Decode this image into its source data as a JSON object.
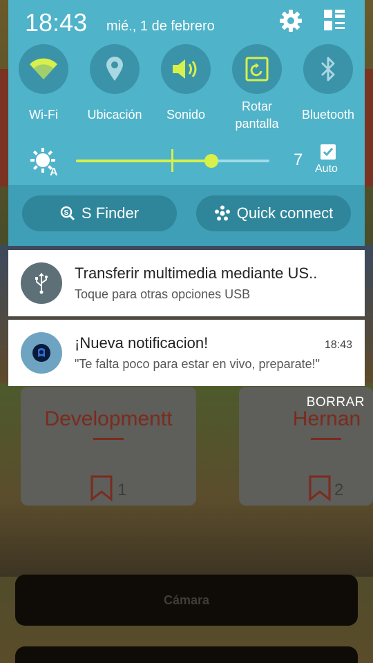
{
  "status_bar": {
    "time": "18:43",
    "date": "mié., 1 de febrero"
  },
  "quick_settings": {
    "tiles": [
      {
        "label": "Wi-Fi",
        "icon": "wifi-icon",
        "active": true
      },
      {
        "label": "Ubicación",
        "icon": "location-icon",
        "active": false
      },
      {
        "label": "Sonido",
        "icon": "sound-icon",
        "active": true
      },
      {
        "label": "Rotar pantalla",
        "icon": "rotate-icon",
        "active": true
      },
      {
        "label": "Bluetooth",
        "icon": "bluetooth-icon",
        "active": false
      }
    ],
    "brightness": {
      "value": "7",
      "level_fraction": 0.7,
      "auto_label": "Auto",
      "auto_checked": true
    },
    "s_finder_label": "S Finder",
    "quick_connect_label": "Quick connect"
  },
  "notifications": [
    {
      "title": "Transferir multimedia mediante US..",
      "body": "Toque para otras opciones USB",
      "icon": "usb-icon",
      "time": ""
    },
    {
      "title": "¡Nueva notificacion!",
      "body": "\"Te falta poco para estar en vivo, preparate!\"",
      "icon": "app-icon",
      "time": "18:43"
    }
  ],
  "background_app": {
    "clear_label": "BORRAR",
    "cards": [
      {
        "title": "Developmentt",
        "count": "1"
      },
      {
        "title": "Hernan",
        "count": "2"
      }
    ],
    "camera_button_label": "Cámara"
  },
  "colors": {
    "panel": "#4fb3c9",
    "tile_circle": "#3a93a8",
    "accent": "#d7f04a"
  }
}
